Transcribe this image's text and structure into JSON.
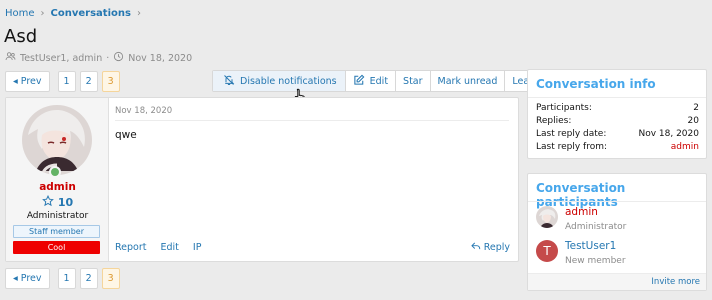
{
  "breadcrumb": {
    "home": "Home",
    "separator": "›",
    "current": "Conversations"
  },
  "page": {
    "title": "Asd",
    "participants": "TestUser1, admin",
    "meta_sep": "·",
    "date": "Nov 18, 2020"
  },
  "pager": {
    "prev": "◂ Prev",
    "pages": [
      "1",
      "2",
      "3"
    ],
    "active": "3"
  },
  "actions": {
    "disable_notifications": "Disable notifications",
    "edit": "Edit",
    "star": "Star",
    "mark_unread": "Mark unread",
    "leave": "Leave"
  },
  "message": {
    "user": {
      "name": "admin",
      "trophy_points": "10",
      "title": "Administrator",
      "banner_staff": "Staff member",
      "banner_custom": "Cool"
    },
    "date": "Nov 18, 2020",
    "body": "qwe",
    "footer": {
      "report": "Report",
      "edit": "Edit",
      "ip": "IP",
      "reply": "Reply"
    }
  },
  "conversation_info": {
    "title": "Conversation info",
    "rows": [
      {
        "label": "Participants:",
        "value": "2"
      },
      {
        "label": "Replies:",
        "value": "20"
      },
      {
        "label": "Last reply date:",
        "value": "Nov 18, 2020"
      },
      {
        "label": "Last reply from:",
        "value": "admin"
      }
    ]
  },
  "participants_block": {
    "title": "Conversation participants",
    "items": [
      {
        "name": "admin",
        "role": "Administrator"
      },
      {
        "name": "TestUser1",
        "role": "New member",
        "initial": "T"
      }
    ],
    "invite_more": "Invite more"
  },
  "colors": {
    "link": "#2577b1",
    "accent": "#47a7eb",
    "admin_red": "#cc0000",
    "banner_red": "#ee0000",
    "active_page": "#dc9a32"
  },
  "icons": [
    "users-icon",
    "clock-icon",
    "bell-slash-icon",
    "edit-icon",
    "star-icon",
    "reply-icon",
    "pointer-cursor-icon"
  ]
}
